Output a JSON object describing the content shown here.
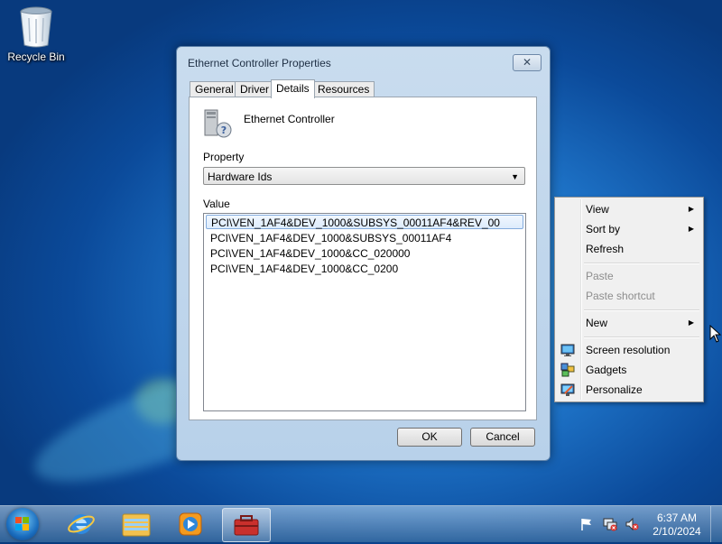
{
  "desktop": {
    "icons": [
      {
        "label": "Recycle Bin",
        "icon": "recycle-bin-icon"
      }
    ]
  },
  "dialog": {
    "title": "Ethernet Controller Properties",
    "close_glyph": "✕",
    "tabs": [
      {
        "label": "General",
        "active": false
      },
      {
        "label": "Driver",
        "active": false
      },
      {
        "label": "Details",
        "active": true
      },
      {
        "label": "Resources",
        "active": false
      }
    ],
    "device_name": "Ethernet Controller",
    "property_label": "Property",
    "property_value": "Hardware Ids",
    "value_label": "Value",
    "values": [
      "PCI\\VEN_1AF4&DEV_1000&SUBSYS_00011AF4&REV_00",
      "PCI\\VEN_1AF4&DEV_1000&SUBSYS_00011AF4",
      "PCI\\VEN_1AF4&DEV_1000&CC_020000",
      "PCI\\VEN_1AF4&DEV_1000&CC_0200"
    ],
    "selected_value_index": 0,
    "ok_label": "OK",
    "cancel_label": "Cancel"
  },
  "context_menu": {
    "items": [
      {
        "label": "View",
        "submenu": true,
        "disabled": false
      },
      {
        "label": "Sort by",
        "submenu": true,
        "disabled": false
      },
      {
        "label": "Refresh",
        "submenu": false,
        "disabled": false
      },
      {
        "label": "Paste",
        "submenu": false,
        "disabled": true
      },
      {
        "label": "Paste shortcut",
        "submenu": false,
        "disabled": true
      },
      {
        "label": "New",
        "submenu": true,
        "disabled": false
      },
      {
        "label": "Screen resolution",
        "submenu": false,
        "disabled": false,
        "icon": "screen-resolution-icon"
      },
      {
        "label": "Gadgets",
        "submenu": false,
        "disabled": false,
        "icon": "gadgets-icon"
      },
      {
        "label": "Personalize",
        "submenu": false,
        "disabled": false,
        "icon": "personalize-icon"
      }
    ]
  },
  "taskbar": {
    "items": [
      "internet-explorer-icon",
      "windows-explorer-icon",
      "media-player-icon",
      "device-manager-icon"
    ],
    "time": "6:37 AM",
    "date": "2/10/2024"
  },
  "colors": {
    "accent": "#1c6fc3",
    "selection_border": "#84acdd"
  }
}
